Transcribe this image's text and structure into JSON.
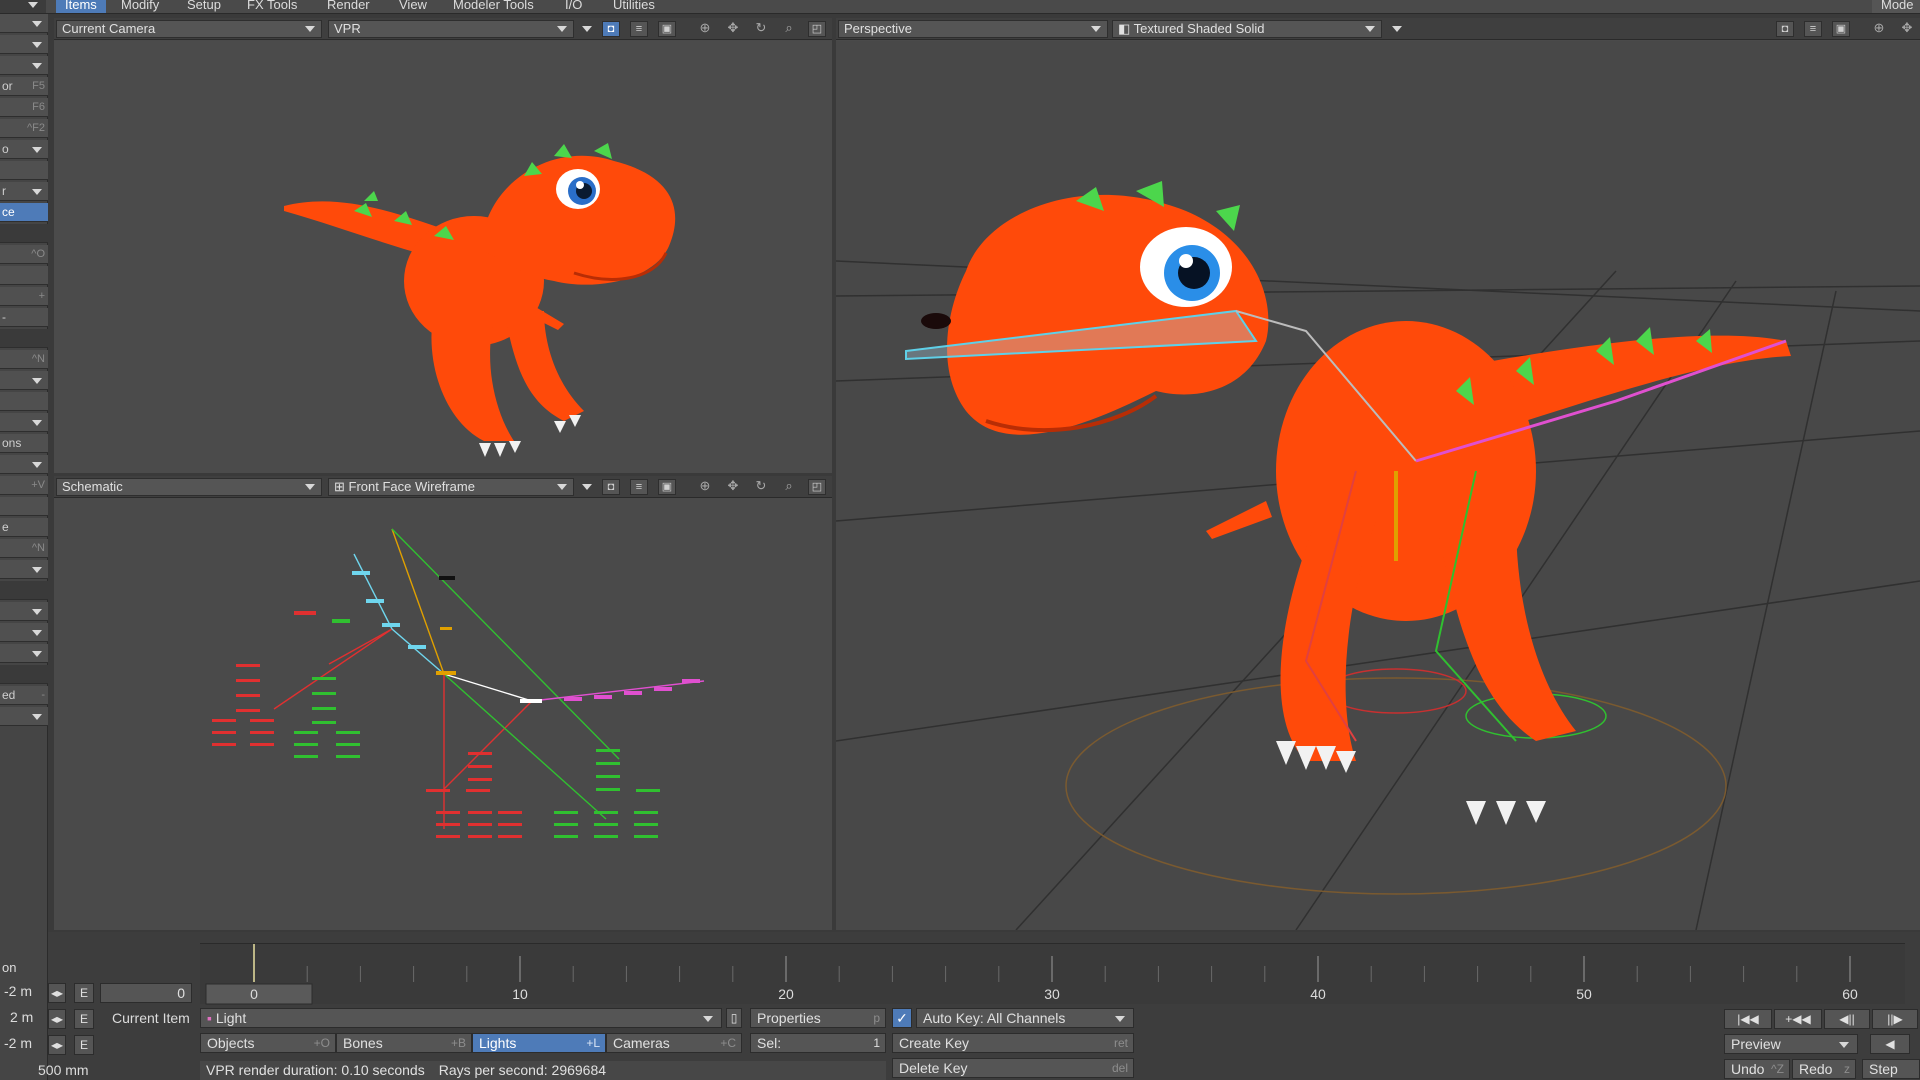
{
  "menubar": {
    "items": [
      "Items",
      "Modify",
      "Setup",
      "FX Tools",
      "Render",
      "View",
      "Modeler Tools",
      "I/O",
      "Utilities"
    ],
    "active": "Items",
    "right_label": "Mode"
  },
  "left_toolbar": {
    "items": [
      {
        "label": "",
        "key": ""
      },
      {
        "label": "",
        "key": ""
      },
      {
        "label": "",
        "key": ""
      },
      {
        "label": "or",
        "key": "F5"
      },
      {
        "label": "",
        "key": "F6"
      },
      {
        "label": "",
        "key": "^F2"
      },
      {
        "label": "o",
        "key": ""
      },
      {
        "label": "",
        "key": ""
      },
      {
        "label": "r",
        "key": ""
      },
      {
        "label": "ce",
        "key": ""
      },
      {
        "label": "",
        "key": ""
      },
      {
        "label": "",
        "key": "^O"
      },
      {
        "label": "",
        "key": ""
      },
      {
        "label": "",
        "key": "+"
      },
      {
        "label": "-",
        "key": ""
      },
      {
        "label": "",
        "key": ""
      },
      {
        "label": "",
        "key": "^N"
      },
      {
        "label": "",
        "key": ""
      },
      {
        "label": "",
        "key": ""
      },
      {
        "label": "",
        "key": ""
      },
      {
        "label": "ons",
        "key": ""
      },
      {
        "label": "",
        "key": ""
      },
      {
        "label": "",
        "key": "+V"
      },
      {
        "label": "",
        "key": ""
      },
      {
        "label": "e",
        "key": ""
      },
      {
        "label": "",
        "key": "^N"
      },
      {
        "label": "",
        "key": ""
      },
      {
        "label": "",
        "key": ""
      },
      {
        "label": "",
        "key": ""
      },
      {
        "label": "",
        "key": ""
      },
      {
        "label": "",
        "key": ""
      },
      {
        "label": "",
        "key": ""
      },
      {
        "label": "ed",
        "key": "-"
      },
      {
        "label": "",
        "key": ""
      }
    ]
  },
  "viewport_top_left": {
    "view": "Current Camera",
    "mode": "VPR"
  },
  "viewport_bottom_left": {
    "view": "Schematic",
    "mode": "Front Face Wireframe"
  },
  "viewport_right": {
    "view": "Perspective",
    "mode": "Textured Shaded Solid"
  },
  "timeline": {
    "ticks": [
      "0",
      "10",
      "20",
      "30",
      "40",
      "50",
      "60"
    ],
    "current_frame": "0"
  },
  "bottom": {
    "rows": [
      {
        "value": "-2 m",
        "e": "E"
      },
      {
        "value": "2 m",
        "e": "E"
      },
      {
        "value": "-2 m",
        "e": "E"
      }
    ],
    "frame_field": "0",
    "grid_size": "500 mm",
    "current_item_label": "Current Item",
    "current_item_value": "Light",
    "properties_label": "Properties",
    "properties_key": "p",
    "auto_key_label": "Auto Key: All Channels",
    "tabs": [
      {
        "label": "Objects",
        "key": "+O"
      },
      {
        "label": "Bones",
        "key": "+B"
      },
      {
        "label": "Lights",
        "key": "+L"
      },
      {
        "label": "Cameras",
        "key": "+C"
      }
    ],
    "sel_label": "Sel:",
    "sel_value": "1",
    "create_key_label": "Create Key",
    "create_key_key": "ret",
    "delete_key_label": "Delete Key",
    "delete_key_key": "del",
    "status_render": "VPR render duration: 0.10 seconds",
    "status_rays": "Rays per second: 2969684",
    "left_on_label": "on",
    "preview_label": "Preview",
    "undo_label": "Undo",
    "undo_key": "^Z",
    "redo_label": "Redo",
    "redo_key": "z",
    "step_label": "Step"
  },
  "colors": {
    "accent": "#4e7bb8",
    "dino_body": "#ff4a0a",
    "dino_stripe": "#4cd64c",
    "bone_cyan": "#5fd0e8",
    "bone_magenta": "#e050d0",
    "bone_red": "#e02828",
    "bone_green": "#30d030"
  }
}
